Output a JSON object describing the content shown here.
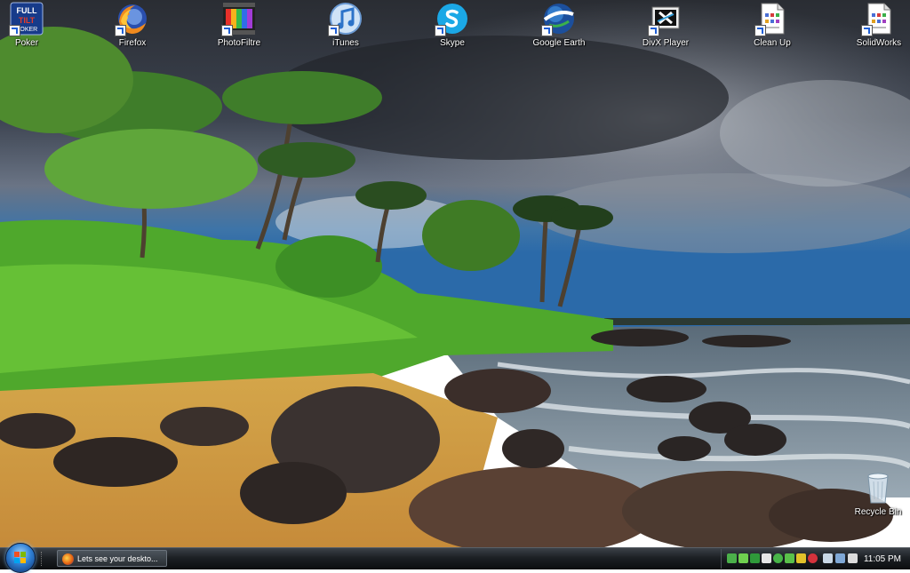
{
  "desktop": {
    "icons": [
      {
        "label": "Poker",
        "icon": "full-tilt-poker-icon"
      },
      {
        "label": "Firefox",
        "icon": "firefox-icon"
      },
      {
        "label": "PhotoFiltre",
        "icon": "photofiltre-icon"
      },
      {
        "label": "iTunes",
        "icon": "itunes-icon"
      },
      {
        "label": "Skype",
        "icon": "skype-icon"
      },
      {
        "label": "Google Earth",
        "icon": "google-earth-icon"
      },
      {
        "label": "DivX Player",
        "icon": "divx-player-icon"
      },
      {
        "label": "Clean Up",
        "icon": "document-icon"
      },
      {
        "label": "SolidWorks",
        "icon": "document-icon"
      },
      {
        "label": "Recycle Bin",
        "icon": "recycle-bin-icon"
      }
    ],
    "poker_logo_text": "FULL TILT POKER",
    "wallpaper": "tropical-beach-hdr"
  },
  "taskbar": {
    "start_icon": "windows-start-orb",
    "active_window": "Lets see your deskto...",
    "clock": "11:05 PM",
    "colors": {
      "bar_top": "#3b4148",
      "bar_bottom": "#0b0d0f",
      "text": "#ffffff"
    }
  }
}
